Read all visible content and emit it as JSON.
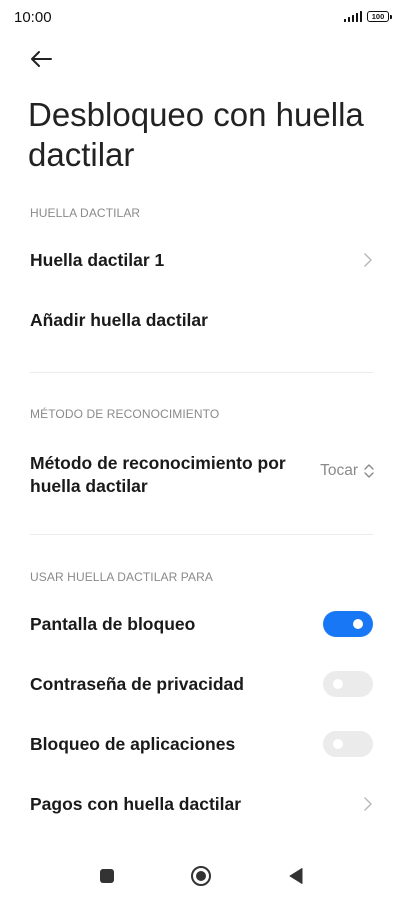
{
  "status_bar": {
    "time": "10:00",
    "battery": "100",
    "icons": [
      "signal-icon",
      "battery-icon"
    ]
  },
  "header": {
    "back_icon": "back-arrow-icon",
    "title": "Desbloqueo con huella dactilar"
  },
  "sections": {
    "fingerprint": {
      "header": "HUELLA DACTILAR",
      "items": [
        {
          "label": "Huella dactilar 1",
          "icon": "chevron-right-icon"
        },
        {
          "label": "Añadir huella dactilar"
        }
      ]
    },
    "recognition": {
      "header": "MÉTODO DE RECONOCIMIENTO",
      "item": {
        "label_line1": "Método de reconocimiento por",
        "label_line2": "huella dactilar",
        "value": "Tocar",
        "icon": "chevron-up-down-icon"
      }
    },
    "usage": {
      "header": "USAR HUELLA DACTILAR PARA",
      "items": [
        {
          "label": "Pantalla de bloqueo",
          "toggle": true
        },
        {
          "label": "Contraseña de privacidad",
          "toggle": false
        },
        {
          "label": "Bloqueo de aplicaciones",
          "toggle": false
        },
        {
          "label": "Pagos con huella dactilar",
          "icon": "chevron-right-icon"
        }
      ]
    }
  },
  "colors": {
    "accent": "#1777f5",
    "toggle_off": "#ebebeb",
    "secondary_text": "#8a8a8a"
  },
  "nav_bar": {
    "icons": [
      "recents-square-icon",
      "home-circle-icon",
      "back-triangle-icon"
    ]
  }
}
